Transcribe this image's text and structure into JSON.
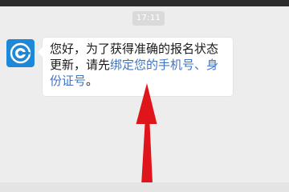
{
  "chat": {
    "timestamp": "17:11",
    "message": {
      "text_prefix": "您好，为了获得准确的报名状态更新，请先",
      "link_text": "绑定您的手机号、身份证号",
      "text_suffix": "。"
    }
  },
  "avatar": {
    "icon": "e-logo-icon",
    "background": "#1e88d8"
  },
  "annotation": {
    "arrow_color": "#e0151b"
  }
}
